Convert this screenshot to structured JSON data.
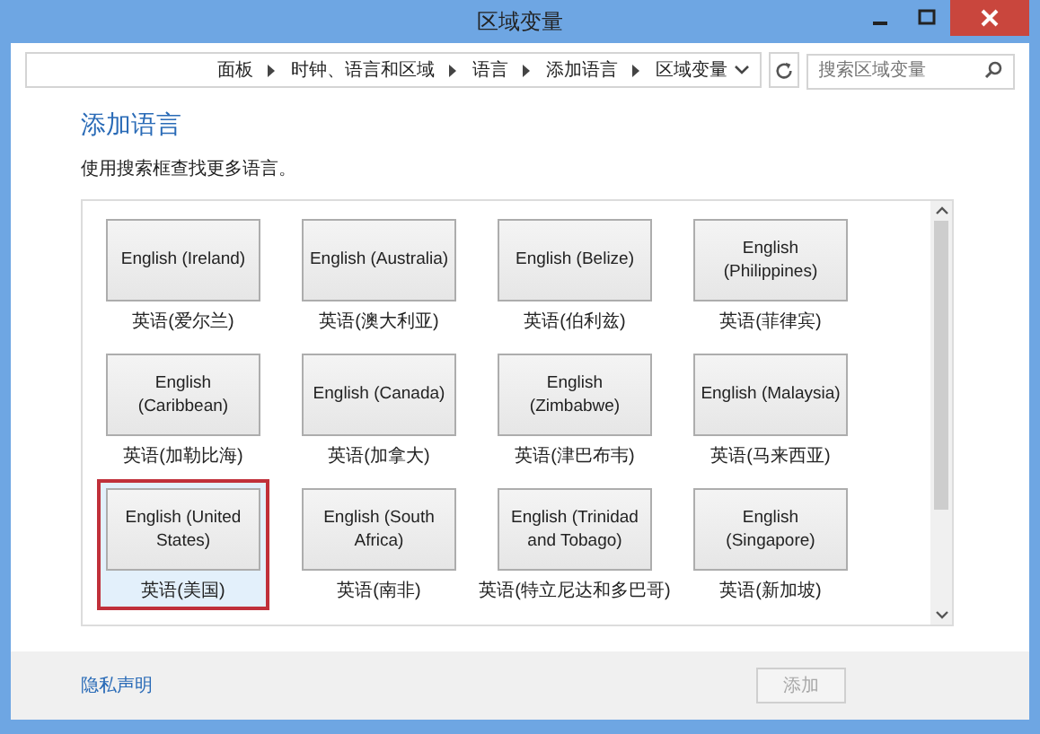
{
  "window": {
    "title": "区域变量"
  },
  "breadcrumb": [
    "面板",
    "时钟、语言和区域",
    "语言",
    "添加语言",
    "区域变量"
  ],
  "search": {
    "placeholder": "搜索区域变量"
  },
  "heading": "添加语言",
  "description": "使用搜索框查找更多语言。",
  "languages": [
    {
      "name": "English (Ireland)",
      "native": "英语(爱尔兰)",
      "selected": false
    },
    {
      "name": "English (Australia)",
      "native": "英语(澳大利亚)",
      "selected": false
    },
    {
      "name": "English (Belize)",
      "native": "英语(伯利兹)",
      "selected": false
    },
    {
      "name": "English (Philippines)",
      "native": "英语(菲律宾)",
      "selected": false
    },
    {
      "name": "English (Caribbean)",
      "native": "英语(加勒比海)",
      "selected": false
    },
    {
      "name": "English (Canada)",
      "native": "英语(加拿大)",
      "selected": false
    },
    {
      "name": "English (Zimbabwe)",
      "native": "英语(津巴布韦)",
      "selected": false
    },
    {
      "name": "English (Malaysia)",
      "native": "英语(马来西亚)",
      "selected": false
    },
    {
      "name": "English (United States)",
      "native": "英语(美国)",
      "selected": true
    },
    {
      "name": "English (South Africa)",
      "native": "英语(南非)",
      "selected": false
    },
    {
      "name": "English (Trinidad and Tobago)",
      "native": "英语(特立尼达和多巴哥)",
      "selected": false
    },
    {
      "name": "English (Singapore)",
      "native": "英语(新加坡)",
      "selected": false
    }
  ],
  "privacy_link": "隐私声明",
  "add_button": {
    "label": "添加",
    "disabled": true
  }
}
